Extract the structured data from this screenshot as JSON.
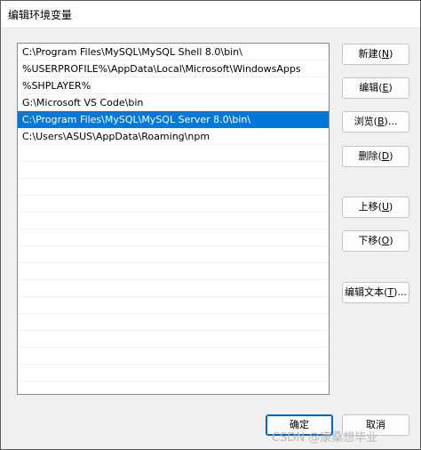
{
  "window": {
    "title": "编辑环境变量"
  },
  "paths": [
    "C:\\Program Files\\MySQL\\MySQL Shell 8.0\\bin\\",
    "%USERPROFILE%\\AppData\\Local\\Microsoft\\WindowsApps",
    "%SHPLAYER%",
    "G:\\Microsoft VS Code\\bin",
    "C:\\Program Files\\MySQL\\MySQL Server 8.0\\bin\\",
    "C:\\Users\\ASUS\\AppData\\Roaming\\npm"
  ],
  "selected_index": 4,
  "buttons": {
    "new": {
      "label": "新建(",
      "key": "N",
      "suffix": ")"
    },
    "edit": {
      "label": "编辑(",
      "key": "E",
      "suffix": ")"
    },
    "browse": {
      "label": "浏览(",
      "key": "B",
      "suffix": ")..."
    },
    "delete": {
      "label": "删除(",
      "key": "D",
      "suffix": ")"
    },
    "move_up": {
      "label": "上移(",
      "key": "U",
      "suffix": ")"
    },
    "move_down": {
      "label": "下移(",
      "key": "O",
      "suffix": ")"
    },
    "edit_text": {
      "label": "编辑文本(",
      "key": "T",
      "suffix": ")..."
    },
    "ok": "确定",
    "cancel": "取消"
  },
  "watermark": "CSDN @康桑想毕业"
}
